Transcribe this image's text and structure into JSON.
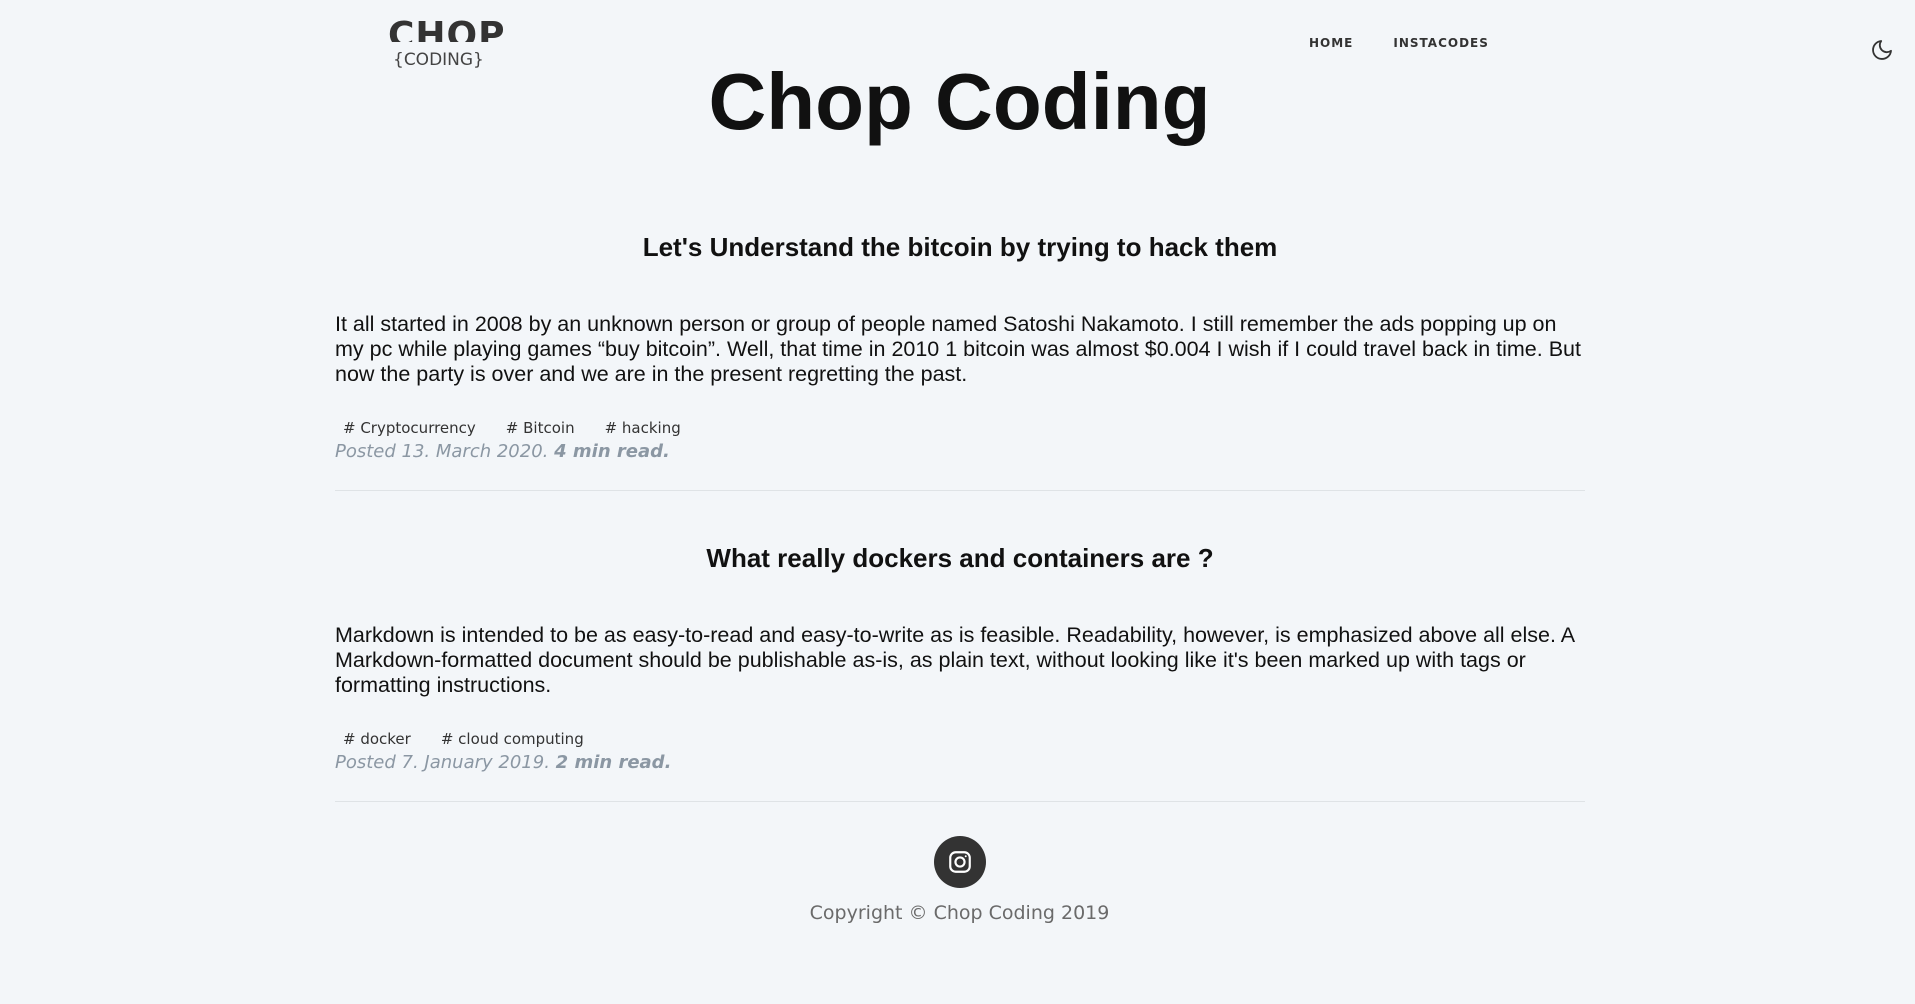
{
  "header": {
    "logo_top": "CHOP",
    "logo_bottom": "{CODING}",
    "nav": [
      {
        "label": "HOME"
      },
      {
        "label": "INSTACODES"
      }
    ],
    "theme_icon": "moon-icon"
  },
  "site_title": "Chop Coding",
  "posts": [
    {
      "title": "Let's Understand the bitcoin by trying to hack them",
      "excerpt": "It all started in 2008 by an unknown person or group of people named Satoshi Nakamoto. I still remember the ads popping up on my pc while playing games “buy bitcoin”. Well, that time in 2010 1 bitcoin was almost $0.004 I wish if I could travel back in time. But now the party is over and we are in the present regretting the past.",
      "tags": [
        "# Cryptocurrency",
        "# Bitcoin",
        "# hacking"
      ],
      "posted": "Posted 13. March 2020.",
      "read_time": "4 min read."
    },
    {
      "title": "What really dockers and containers are ?",
      "excerpt": "Markdown is intended to be as easy-to-read and easy-to-write as is feasible. Readability, however, is emphasized above all else. A Markdown-formatted document should be publishable as-is, as plain text, without looking like it's been marked up with tags or formatting instructions.",
      "tags": [
        "# docker",
        "# cloud computing"
      ],
      "posted": "Posted 7. January 2019.",
      "read_time": "2 min read."
    }
  ],
  "footer": {
    "social_icon": "instagram-icon",
    "copyright": "Copyright © Chop Coding 2019"
  }
}
